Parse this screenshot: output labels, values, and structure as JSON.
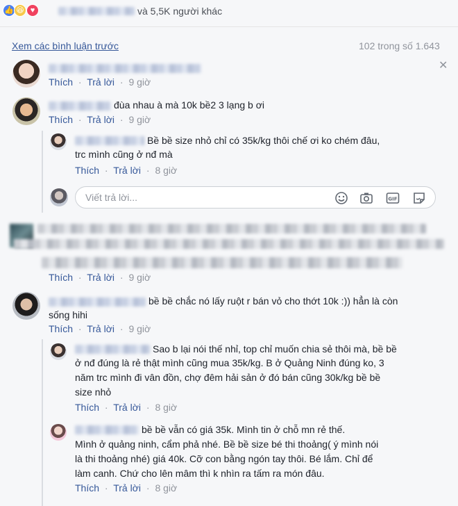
{
  "reactions": {
    "icons": [
      "like-icon",
      "haha-icon",
      "love-icon"
    ],
    "colors": {
      "like": "#4a7ff2",
      "haha": "#f7c94a",
      "love": "#f0425f"
    },
    "others_text": "và 5,5K người khác"
  },
  "previous": {
    "link": "Xem các bình luận trước",
    "count": "102 trong số 1.643"
  },
  "actions": {
    "like": "Thích",
    "reply": "Trả lời"
  },
  "comments": [
    {
      "text": "",
      "time": "9 giờ"
    },
    {
      "text": "đùa nhau à mà 10k bề2 3 lạng b ơi",
      "time": "9 giờ",
      "replies": [
        {
          "text_line1": "Bề bề size nhỏ chỉ có 35k/kg thôi chế ơi ko chém đâu,",
          "text_line2": "trc mình cũng ở nđ mà",
          "time": "8 giờ"
        }
      ]
    },
    {
      "text": "",
      "time": "9 giờ"
    },
    {
      "text_line1": "bề bề chắc nó lấy ruột r bán vỏ cho thớt 10k :)) hẳn là còn",
      "text_line2": "sống hihi",
      "time": "9 giờ",
      "replies": [
        {
          "lines": [
            "Sao b lại nói thế nhỉ, top chỉ muốn chia sẻ thôi mà, bề bề",
            "ở nđ đúng là rẻ thật mình cũng mua 35k/kg. B ở Quảng Ninh đúng ko, 3",
            "năm trc mình đi vân đồn, chợ đêm hải sản ở đó bán cũng 30k/kg bề bề",
            "size nhỏ"
          ],
          "time": "8 giờ"
        },
        {
          "lines": [
            "bề bề vẫn có giá 35k. Mình tin ở chỗ mn rẻ thế.",
            "Mình ở quảng ninh, cẩm phả nhé. Bề bề size bé thi thoảng( ý mình nói",
            "là thi thoảng nhé) giá 40k. Cỡ con bằng ngón tay thôi. Bé lắm. Chỉ để",
            "làm canh. Chứ cho lên mâm thì k nhìn ra tấm ra món đâu."
          ],
          "time": "8 giờ"
        }
      ]
    }
  ],
  "reply_box": {
    "placeholder": "Viết trả lời..."
  },
  "tools": [
    "emoji-icon",
    "camera-icon",
    "gif-icon",
    "sticker-icon"
  ],
  "close_glyph": "✕",
  "separator": "·"
}
